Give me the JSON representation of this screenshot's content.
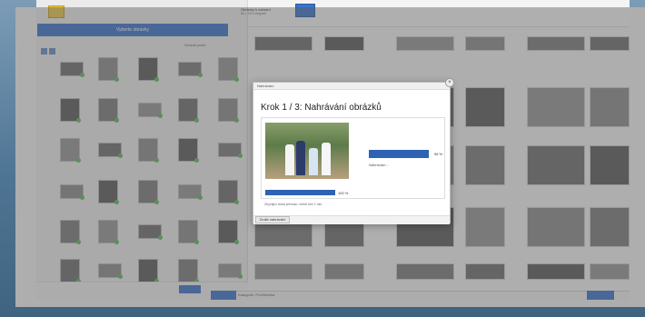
{
  "dialog": {
    "title": "Nahrávání",
    "heading": "Krok 1 / 3: Nahrávání obrázků",
    "file_progress": 1.0,
    "file_percent": "100 %",
    "total_progress": 0.96,
    "total_percent": "96 %",
    "status": "Nahrávám...",
    "remaining": "Zbývající doba přenosu: méně než 1 min",
    "cancel_label": "Zrušit nahrávání",
    "close_symbol": "×"
  },
  "left_panel": {
    "upload_button": "Vyberte obrázky",
    "sort_label": "Seřadit podle"
  },
  "header": {
    "title": "Obrázky k nahrání",
    "subtitle": "85 z 100 fotografií"
  },
  "bottom": {
    "label": "Kategorie: Prohlížečka"
  },
  "colors": {
    "accent": "#2e63b4",
    "badge": "#5cb85c"
  }
}
